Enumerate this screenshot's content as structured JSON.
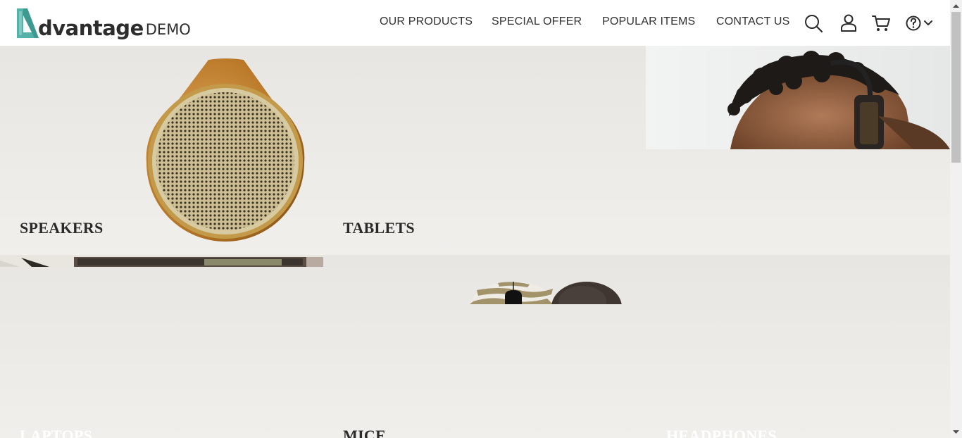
{
  "brand": {
    "name": "dvantage",
    "suffix": "DEMO",
    "accent": "#53b3a8"
  },
  "nav": {
    "items": [
      {
        "label": "OUR PRODUCTS"
      },
      {
        "label": "SPECIAL OFFER"
      },
      {
        "label": "POPULAR ITEMS"
      },
      {
        "label": "CONTACT US"
      }
    ],
    "icons": [
      "search-icon",
      "user-icon",
      "cart-icon",
      "help-icon",
      "chevron-down-icon"
    ]
  },
  "categories": {
    "speakers": "SPEAKERS",
    "tablets": "TABLETS",
    "laptops": "LAPTOPS",
    "mice": "MICE",
    "headphones": "HEADPHONES"
  }
}
